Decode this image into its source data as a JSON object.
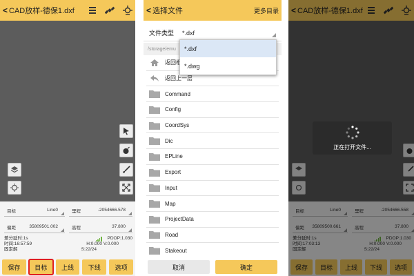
{
  "colors": {
    "accent": "#f5c85a",
    "map_bg": "#5c5c5c",
    "highlight": "#e02020",
    "selected": "#dbe7f6"
  },
  "left_screen": {
    "title": "CAD放样-德保1.dxf",
    "icons": [
      "menu-icon",
      "satellite-icon",
      "gps-antenna-icon"
    ],
    "map_tools_right": [
      "pointer-icon",
      "bomb-icon",
      "brush-icon",
      "expand-icon"
    ],
    "map_tools_left": [
      "layers-icon",
      "locate-icon"
    ],
    "fields": [
      {
        "label": "目标",
        "value": "Line0"
      },
      {
        "label": "里程",
        "value": "-2054666.578"
      },
      {
        "label": "偏距",
        "value": "35809501.002"
      },
      {
        "label": "高程",
        "value": "37.800"
      }
    ],
    "status": {
      "diff_delay": "差分延时:1s",
      "time": "时间:16:57:59",
      "solution": "固定解",
      "pdop": "PDOP:1.030",
      "hv": "H:0.000  V:0.000",
      "sats": "S:22/24"
    },
    "buttons": [
      "保存",
      "目标",
      "上线",
      "下线",
      "选项"
    ],
    "highlighted_button": "目标"
  },
  "file_chooser": {
    "title": "选择文件",
    "more_label": "更多目录",
    "type_label": "文件类型",
    "type_value": "*.dxf",
    "path": "/storage/emu",
    "dropdown_options": [
      "*.dxf",
      "*.dwg"
    ],
    "dropdown_selected": "*.dxf",
    "items": [
      {
        "name": "返回根目录",
        "icon": "home-icon"
      },
      {
        "name": "返回上一层",
        "icon": "back-arrow-icon"
      },
      {
        "name": "Command",
        "icon": "folder-icon"
      },
      {
        "name": "Config",
        "icon": "folder-icon"
      },
      {
        "name": "CoordSys",
        "icon": "folder-icon"
      },
      {
        "name": "Dic",
        "icon": "folder-icon"
      },
      {
        "name": "EPLine",
        "icon": "folder-icon"
      },
      {
        "name": "Export",
        "icon": "folder-icon"
      },
      {
        "name": "Input",
        "icon": "folder-icon"
      },
      {
        "name": "Map",
        "icon": "folder-icon"
      },
      {
        "name": "ProjectData",
        "icon": "folder-icon"
      },
      {
        "name": "Road",
        "icon": "folder-icon"
      },
      {
        "name": "Stakeout",
        "icon": "folder-icon"
      }
    ],
    "cancel_label": "取消",
    "ok_label": "确定"
  },
  "right_screen": {
    "title": "CAD放样-德保1.dxf",
    "loading_text": "正在打开文件...",
    "fields": [
      {
        "label": "目标",
        "value": "Line0"
      },
      {
        "label": "里程",
        "value": "-2054666.558"
      },
      {
        "label": "偏距",
        "value": "35809500.661"
      },
      {
        "label": "高程",
        "value": "37.800"
      }
    ],
    "status": {
      "diff_delay": "差分延时:1s",
      "time": "时间:17:03:13",
      "solution": "固定解",
      "pdop": "PDOP:1.030",
      "hv": "H:0.000  V:0.000",
      "sats": "S:22/24"
    },
    "buttons": [
      "保存",
      "目标",
      "上线",
      "下线",
      "选项"
    ]
  }
}
